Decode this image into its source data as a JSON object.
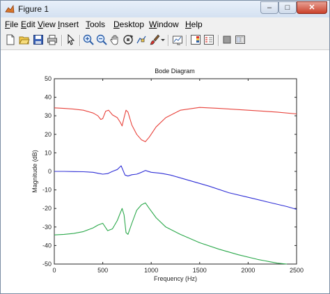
{
  "window": {
    "title": "Figure 1",
    "controls": {
      "minimize": "–",
      "maximize": "□",
      "close": "✕"
    }
  },
  "menubar": {
    "items": [
      {
        "label": "File",
        "mnemonic": "F"
      },
      {
        "label": "Edit",
        "mnemonic": "E"
      },
      {
        "label": "View",
        "mnemonic": "V"
      },
      {
        "label": "Insert",
        "mnemonic": "I"
      },
      {
        "label": "Tools",
        "mnemonic": "T"
      },
      {
        "label": "Desktop",
        "mnemonic": "D"
      },
      {
        "label": "Window",
        "mnemonic": "W"
      },
      {
        "label": "Help",
        "mnemonic": "H"
      }
    ]
  },
  "toolbar": {
    "icons": [
      "new-figure-icon",
      "open-file-icon",
      "save-icon",
      "print-icon",
      "pointer-icon",
      "zoom-in-icon",
      "zoom-out-icon",
      "pan-icon",
      "rotate-3d-icon",
      "data-cursor-icon",
      "brush-icon",
      "brush-dropdown-icon",
      "link-plot-icon",
      "insert-colorbar-icon",
      "insert-legend-icon",
      "hide-plot-tools-icon",
      "show-plot-tools-icon"
    ]
  },
  "chart_data": {
    "type": "line",
    "title": "Bode Diagram",
    "xlabel": "Frequency  (Hz)",
    "ylabel": "Magnitude (dB)",
    "xlim": [
      0,
      2500
    ],
    "ylim": [
      -50,
      50
    ],
    "xticks": [
      "0",
      "500",
      "1000",
      "1500",
      "2000",
      "2500"
    ],
    "yticks": [
      "-50",
      "-40",
      "-30",
      "-20",
      "-10",
      "0",
      "10",
      "20",
      "30",
      "40",
      "50"
    ],
    "grid": false,
    "series": [
      {
        "color": "#e8413a",
        "x": [
          0,
          100,
          200,
          300,
          400,
          450,
          480,
          500,
          530,
          560,
          600,
          650,
          680,
          700,
          720,
          740,
          760,
          800,
          850,
          900,
          940,
          980,
          1050,
          1150,
          1300,
          1500,
          1700,
          2000,
          2300,
          2500
        ],
        "y": [
          34.3,
          34.0,
          33.6,
          33.0,
          31.5,
          30.0,
          28.0,
          28.5,
          32.5,
          33.0,
          30.5,
          29.0,
          26.5,
          24.5,
          29.0,
          33.0,
          32.0,
          25.0,
          20.0,
          17.0,
          16.0,
          18.5,
          24.0,
          29.0,
          33.0,
          34.5,
          34.0,
          33.0,
          32.0,
          31.0
        ]
      },
      {
        "color": "#2f2fd6",
        "x": [
          0,
          100,
          200,
          300,
          400,
          450,
          500,
          550,
          600,
          650,
          690,
          710,
          730,
          760,
          800,
          850,
          900,
          940,
          1000,
          1100,
          1200,
          1300,
          1400,
          1600,
          1800,
          2000,
          2200,
          2400,
          2500
        ],
        "y": [
          0.0,
          0.0,
          -0.1,
          -0.2,
          -0.5,
          -1.0,
          -1.5,
          -1.2,
          0.0,
          1.0,
          3.0,
          0.5,
          -2.0,
          -2.5,
          -1.8,
          -1.5,
          -0.5,
          0.5,
          -0.5,
          -1.0,
          -2.0,
          -3.5,
          -5.0,
          -8.0,
          -11.5,
          -14.0,
          -16.5,
          -19.0,
          -20.5
        ]
      },
      {
        "color": "#2aa84a",
        "x": [
          0,
          100,
          200,
          300,
          400,
          450,
          500,
          550,
          600,
          650,
          680,
          700,
          720,
          740,
          760,
          800,
          850,
          900,
          940,
          980,
          1050,
          1150,
          1300,
          1500,
          1700,
          1900,
          2100,
          2300,
          2400
        ],
        "y": [
          -34.3,
          -34.0,
          -33.5,
          -32.5,
          -30.5,
          -29.0,
          -28.0,
          -32.0,
          -31.0,
          -26.5,
          -22.5,
          -20.0,
          -23.5,
          -33.0,
          -34.0,
          -28.0,
          -21.0,
          -18.0,
          -17.0,
          -20.0,
          -25.0,
          -30.0,
          -34.0,
          -38.5,
          -42.0,
          -45.0,
          -47.5,
          -49.5,
          -50.0
        ]
      }
    ]
  }
}
